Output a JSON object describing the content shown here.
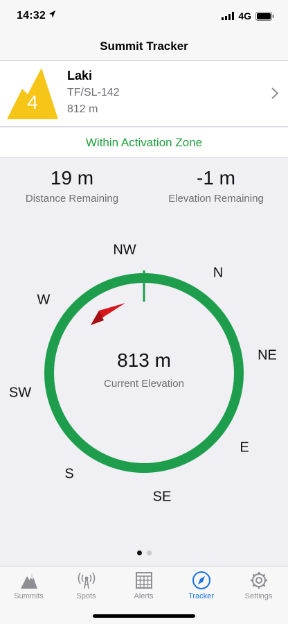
{
  "status_bar": {
    "time": "14:32",
    "network": "4G",
    "icons": [
      "location-arrow-icon",
      "signal-bars-icon",
      "battery-icon"
    ]
  },
  "nav": {
    "title": "Summit Tracker"
  },
  "summit": {
    "points": "4",
    "name": "Laki",
    "reference": "TF/SL-142",
    "elevation": "812 m",
    "badge_color": "#f5c518",
    "icon": "chevron-right-icon"
  },
  "zone": {
    "text": "Within Activation Zone",
    "color": "#1f9e3c"
  },
  "stats": {
    "distance_value": "19 m",
    "distance_label": "Distance Remaining",
    "elevation_value": "-1 m",
    "elevation_label": "Elevation Remaining"
  },
  "compass": {
    "directions": {
      "nw": "NW",
      "n": "N",
      "ne": "NE",
      "e": "E",
      "se": "SE",
      "s": "S",
      "sw": "SW",
      "w": "W"
    },
    "current_elevation": "813 m",
    "current_elevation_label": "Current Elevation",
    "ring_color": "#1e9e4c",
    "pointer_color": "#d9161c"
  },
  "pager": {
    "pages": 2,
    "current": 1
  },
  "tabs": [
    {
      "label": "Summits",
      "icon": "mountain-icon",
      "active": false
    },
    {
      "label": "Spots",
      "icon": "antenna-icon",
      "active": false
    },
    {
      "label": "Alerts",
      "icon": "calendar-icon",
      "active": false
    },
    {
      "label": "Tracker",
      "icon": "compass-icon",
      "active": true
    },
    {
      "label": "Settings",
      "icon": "gear-icon",
      "active": false
    }
  ]
}
